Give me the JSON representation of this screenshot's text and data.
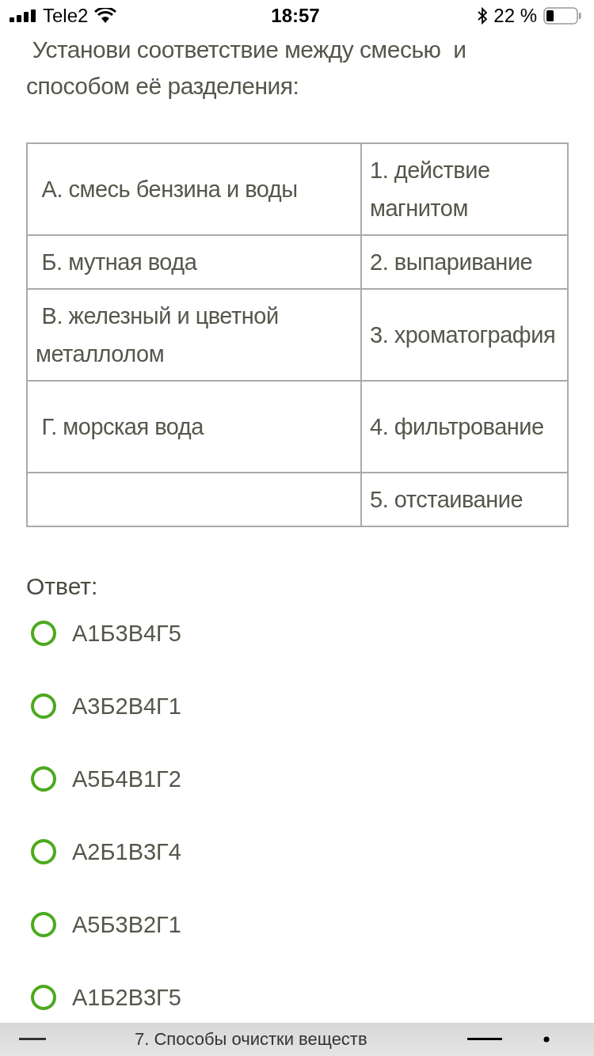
{
  "status_bar": {
    "carrier": "Tele2",
    "time": "18:57",
    "battery": "22 %"
  },
  "question": " Установи соответствие между смесью  и способом её разделения:",
  "table": {
    "rows": [
      {
        "column_1": " А. смесь бензина и воды",
        "column_2": "1. действие магнитом"
      },
      {
        "column_1": " Б. мутная вода",
        "column_2": "2. выпаривание"
      },
      {
        "column_1": " В. железный и цветной металлолом",
        "column_2": "3. хроматография"
      },
      {
        "column_1": " Г. морская вода",
        "column_2": "4. фильтрование"
      },
      {
        "column_1": "",
        "column_2": "5. отстаивание"
      }
    ]
  },
  "answer_label": "Ответ:",
  "options": [
    {
      "label": "А1Б3В4Г5",
      "selected": false
    },
    {
      "label": "А3Б2В4Г1",
      "selected": false
    },
    {
      "label": "А5Б4В1Г2",
      "selected": false
    },
    {
      "label": "А2Б1В3Г4",
      "selected": false
    },
    {
      "label": "А5Б3В2Г1",
      "selected": false
    },
    {
      "label": "А1Б2В3Г5",
      "selected": false
    }
  ],
  "bottom_bar": {
    "title": "7. Способы очистки веществ"
  }
}
